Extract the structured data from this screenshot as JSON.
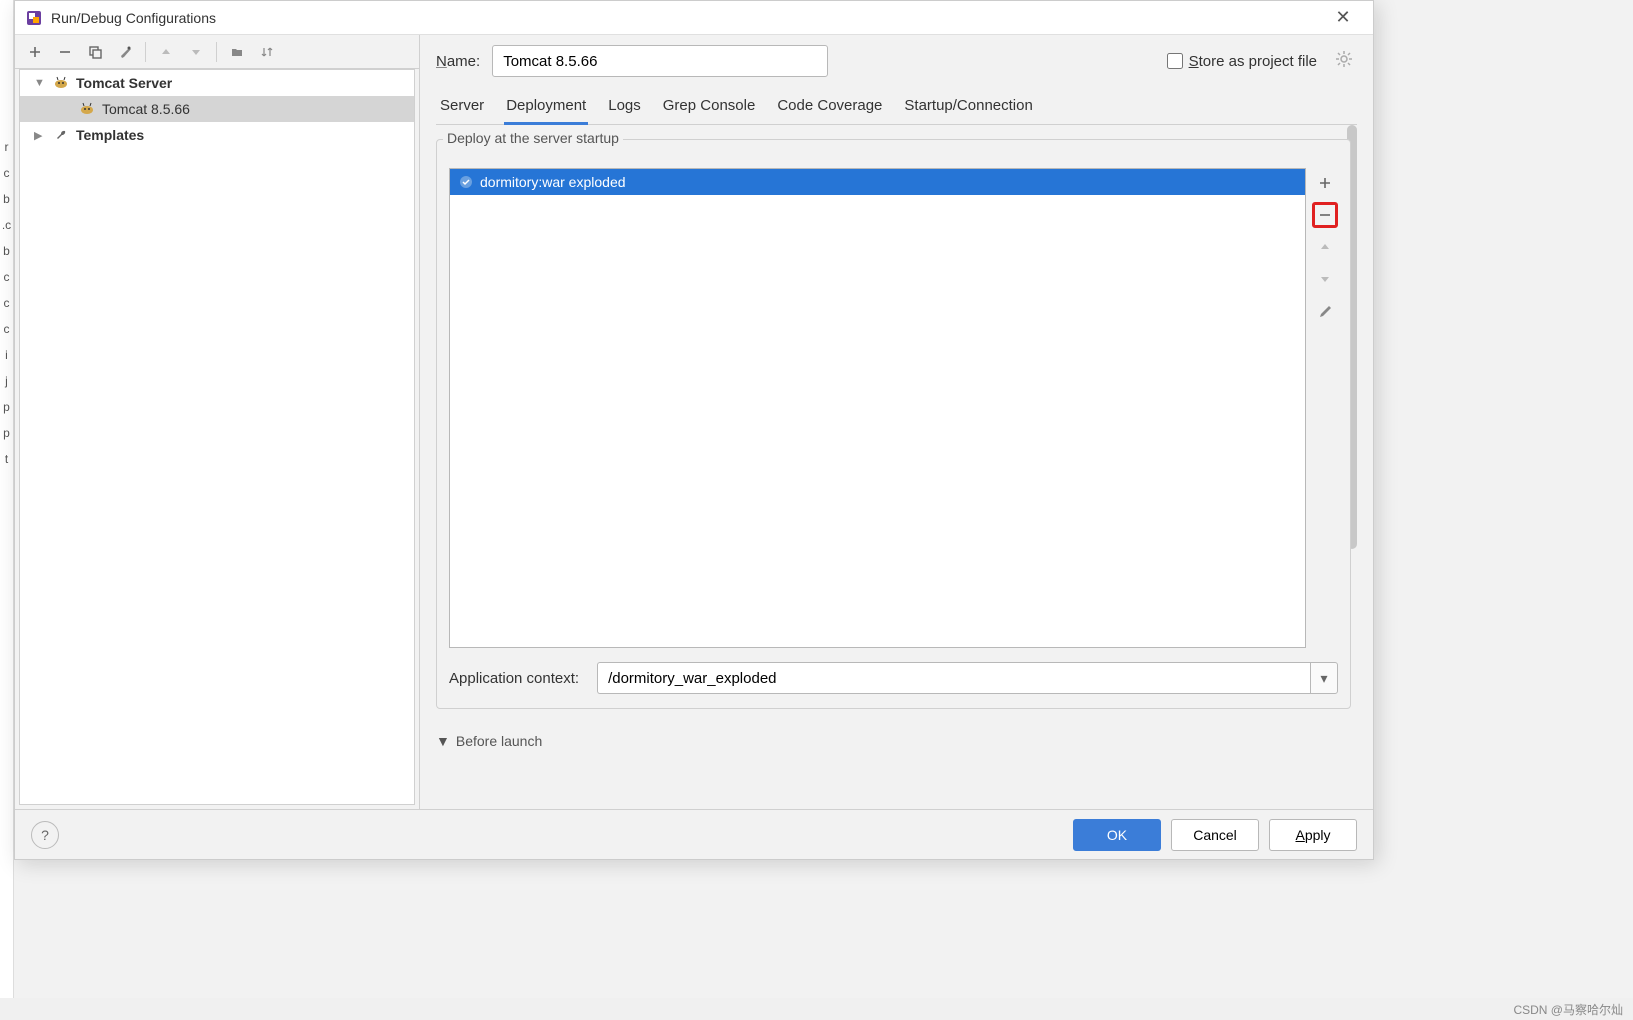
{
  "dialog": {
    "title": "Run/Debug Configurations",
    "name_label_html": "Name:",
    "name_value": "Tomcat 8.5.66",
    "store_label_html": "Store as project file",
    "ok": "OK",
    "cancel": "Cancel",
    "apply": "Apply"
  },
  "tree": {
    "server_group": "Tomcat Server",
    "server_item": "Tomcat 8.5.66",
    "templates": "Templates"
  },
  "tabs": {
    "server": "Server",
    "deployment": "Deployment",
    "logs": "Logs",
    "grep": "Grep Console",
    "coverage": "Code Coverage",
    "startup": "Startup/Connection"
  },
  "deploy": {
    "legend": "Deploy at the server startup",
    "artifact": "dormitory:war exploded",
    "app_ctx_label": "Application context:",
    "app_ctx_value": "/dormitory_war_exploded",
    "before_launch": "Before launch"
  },
  "watermark": "CSDN @马察哈尔灿"
}
